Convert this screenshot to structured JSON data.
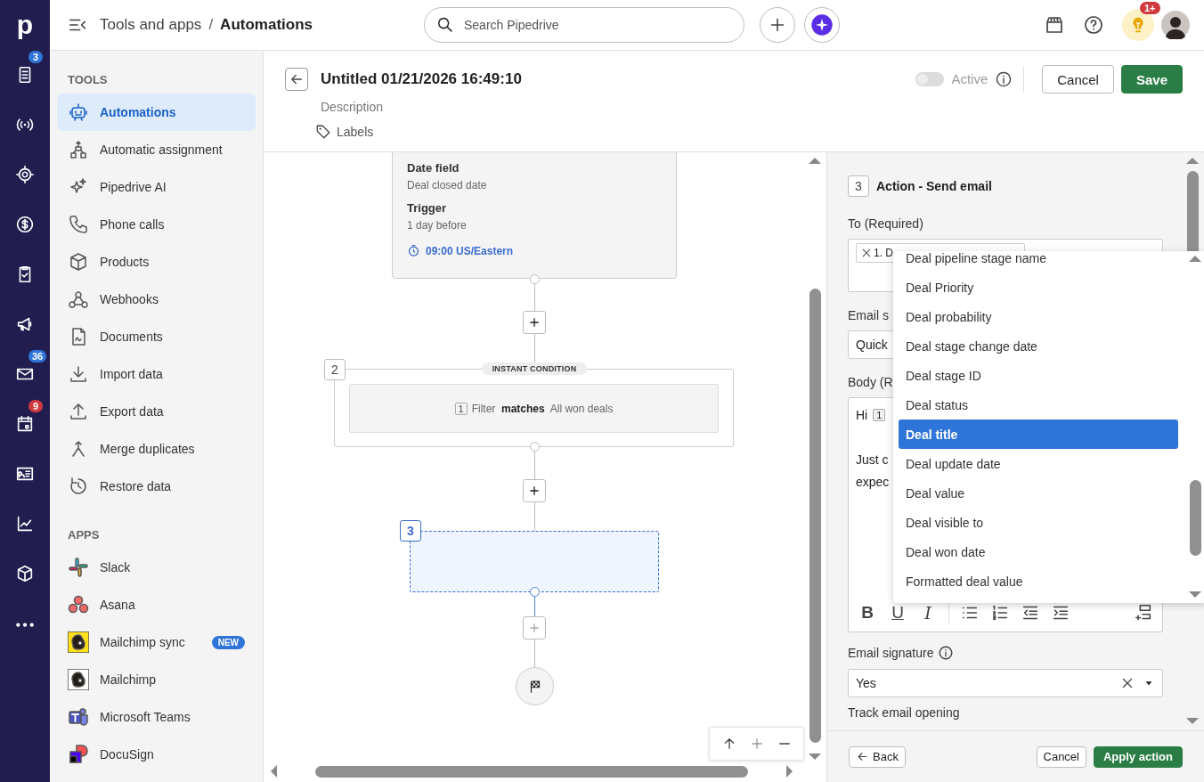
{
  "rail": {
    "logo": "p",
    "badges": [
      {
        "badge": "3",
        "color": "#2f74d8"
      },
      {
        "badge": "36",
        "color": "#2f74d8"
      },
      {
        "badge": "9",
        "color": "#d0393e"
      }
    ]
  },
  "topbar": {
    "breadcrumb": [
      "Tools and apps",
      "Automations"
    ],
    "separator": "/",
    "search": {
      "placeholder": "Search Pipedrive"
    },
    "notification_badge": "1+"
  },
  "sidebar": {
    "sections": [
      {
        "heading": "TOOLS",
        "items": [
          {
            "label": "Automations",
            "selected": true
          },
          {
            "label": "Automatic assignment",
            "selected": false
          },
          {
            "label": "Pipedrive AI",
            "selected": false
          },
          {
            "label": "Phone calls",
            "selected": false
          },
          {
            "label": "Products",
            "selected": false
          },
          {
            "label": "Webhooks",
            "selected": false
          },
          {
            "label": "Documents",
            "selected": false
          },
          {
            "label": "Import data",
            "selected": false
          },
          {
            "label": "Export data",
            "selected": false
          },
          {
            "label": "Merge duplicates",
            "selected": false
          },
          {
            "label": "Restore data",
            "selected": false
          }
        ]
      },
      {
        "heading": "APPS",
        "items": [
          {
            "label": "Slack",
            "selected": false
          },
          {
            "label": "Asana",
            "selected": false
          },
          {
            "label": "Mailchimp sync",
            "selected": false,
            "badge": "NEW"
          },
          {
            "label": "Mailchimp",
            "selected": false
          },
          {
            "label": "Microsoft Teams",
            "selected": false
          },
          {
            "label": "DocuSign",
            "selected": false
          }
        ]
      }
    ]
  },
  "editor": {
    "title": "Untitled 01/21/2026 16:49:10",
    "description_placeholder": "Description",
    "labels": "Labels",
    "active": {
      "label": "Active",
      "on": false
    },
    "cancel": "Cancel",
    "save": "Save"
  },
  "canvas": {
    "trigger": {
      "fields": [
        {
          "label": "Date field",
          "value": "Deal closed date"
        },
        {
          "label": "Trigger",
          "value": "1 day before"
        }
      ],
      "time": "09:00 US/Eastern"
    },
    "condition": {
      "number": "2",
      "label": "INSTANT CONDITION",
      "filter_index": "1",
      "filter": "Filter  **matches**  All won deals"
    },
    "action": {
      "number": "3",
      "selected": true
    }
  },
  "panel": {
    "step": "3",
    "title": "Action - Send email",
    "to": {
      "label": "To (Required)",
      "chip": "1. D"
    },
    "subject": {
      "label": "Email s",
      "value": "Quick"
    },
    "body": {
      "label": "Body (R",
      "lines": [
        {
          "text": "Hi",
          "token": "1"
        },
        {
          "text": "Just c"
        },
        {
          "text": "expec"
        }
      ],
      "format_buttons": [
        "B",
        "U",
        "I"
      ]
    },
    "signature": {
      "label": "Email signature",
      "value": "Yes"
    },
    "tracking": {
      "label": "Track email opening"
    },
    "dropdown": {
      "items": [
        {
          "label": "Deal pipeline stage name",
          "selected": false
        },
        {
          "label": "Deal Priority",
          "selected": false
        },
        {
          "label": "Deal probability",
          "selected": false
        },
        {
          "label": "Deal stage change date",
          "selected": false
        },
        {
          "label": "Deal stage ID",
          "selected": false
        },
        {
          "label": "Deal status",
          "selected": false
        },
        {
          "label": "Deal title",
          "selected": true
        },
        {
          "label": "Deal update date",
          "selected": false
        },
        {
          "label": "Deal value",
          "selected": false
        },
        {
          "label": "Deal visible to",
          "selected": false
        },
        {
          "label": "Deal won date",
          "selected": false
        },
        {
          "label": "Formatted deal value",
          "selected": false
        }
      ]
    },
    "footer": {
      "back": "Back",
      "cancel": "Cancel",
      "apply": "Apply action"
    }
  }
}
